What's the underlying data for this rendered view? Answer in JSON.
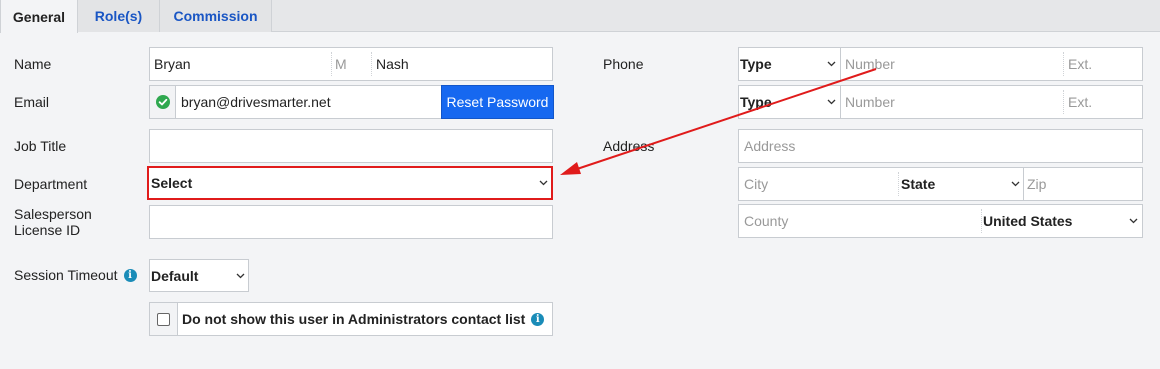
{
  "tabs": [
    {
      "label": "General"
    },
    {
      "label": "Role(s)"
    },
    {
      "label": "Commission"
    }
  ],
  "left": {
    "name_label": "Name",
    "first_name": "Bryan",
    "middle_placeholder": "M",
    "last_name": "Nash",
    "email_label": "Email",
    "email_value": "bryan@drivesmarter.net",
    "reset_password_label": "Reset Password",
    "job_title_label": "Job Title",
    "job_title_value": "",
    "department_label": "Department",
    "department_value": "Select",
    "salesperson_label_line1": "Salesperson",
    "salesperson_label_line2": "License ID",
    "salesperson_value": "",
    "session_timeout_label": "Session Timeout",
    "session_timeout_value": "Default",
    "hide_contact_label": "Do not show this user in Administrators contact list"
  },
  "right": {
    "phone_label": "Phone",
    "phones": [
      {
        "type": "Type",
        "number_placeholder": "Number",
        "ext_placeholder": "Ext."
      },
      {
        "type": "Type",
        "number_placeholder": "Number",
        "ext_placeholder": "Ext."
      }
    ],
    "address_label": "Address",
    "address_placeholder": "Address",
    "city_placeholder": "City",
    "state_value": "State",
    "zip_placeholder": "Zip",
    "county_placeholder": "County",
    "country_value": "United States"
  },
  "colors": {
    "accent": "#1668f0",
    "tab_link": "#1a56c4",
    "annotation_red": "#e01b1b",
    "check_green": "#2fa84f"
  },
  "icons": {
    "chevron": "chevron-down-icon",
    "check": "check-circle-icon",
    "info": "info-icon"
  }
}
